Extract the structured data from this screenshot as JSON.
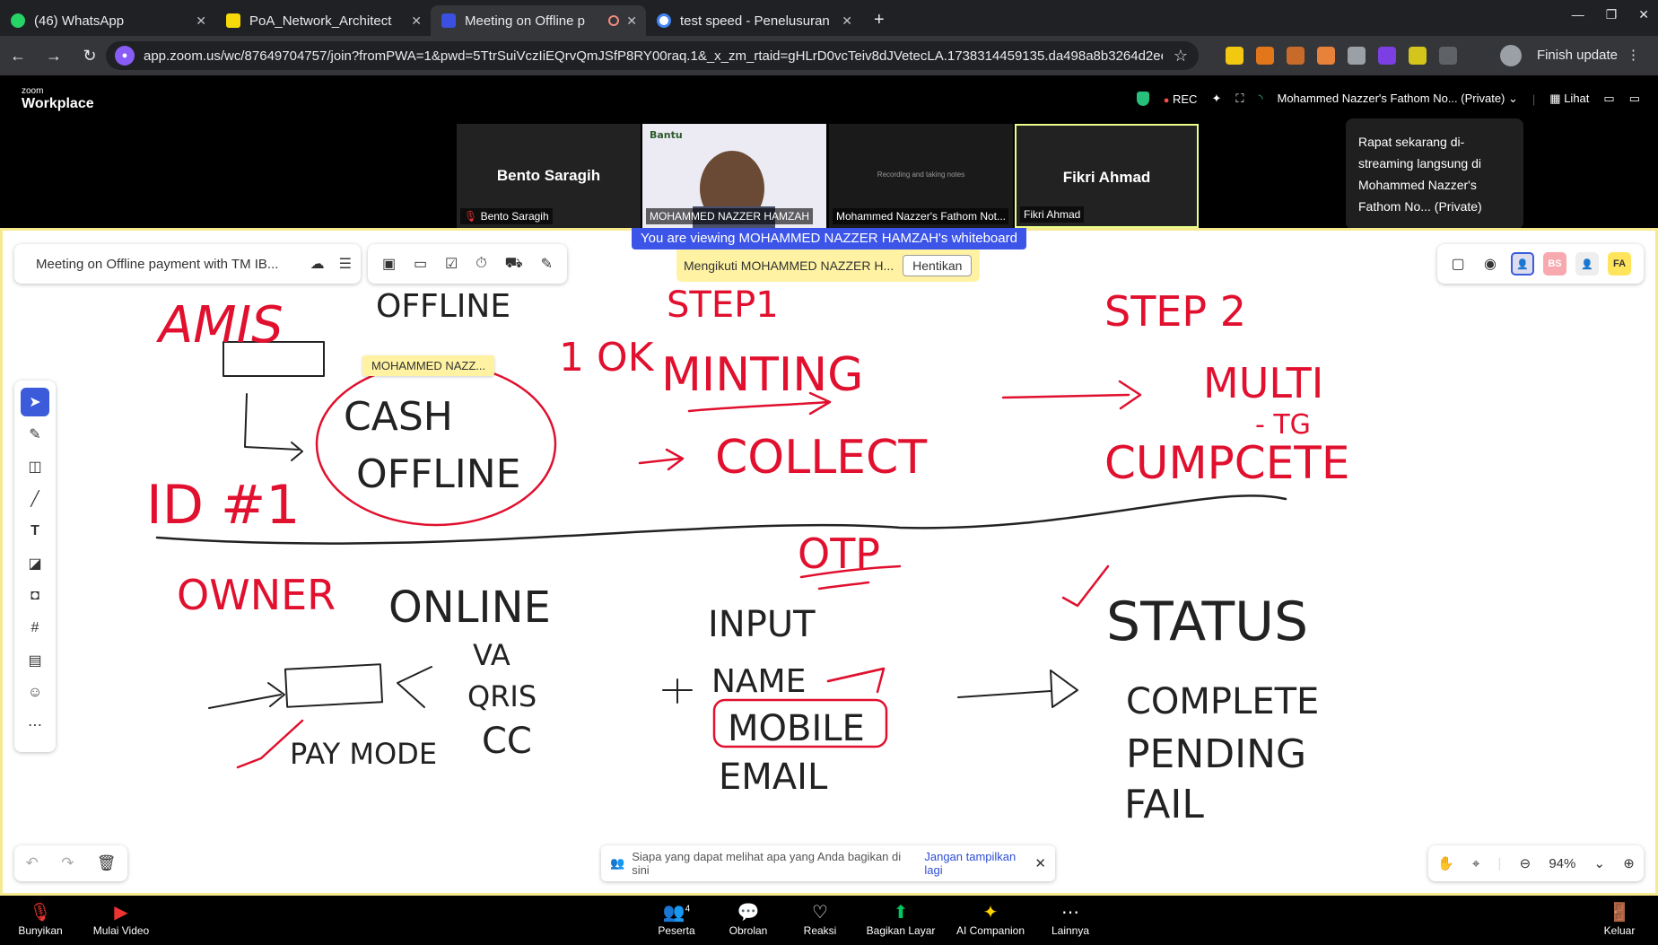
{
  "browser": {
    "tabs": [
      {
        "title": "(46) WhatsApp",
        "favicon_color": "#25d366",
        "active": false
      },
      {
        "title": "PoA_Network_Architect",
        "favicon_color": "#f5d90a",
        "active": false
      },
      {
        "title": "Meeting on Offline p",
        "favicon_color": "#3b4fe0",
        "active": true
      },
      {
        "title": "test speed - Penelusuran",
        "favicon_color": "#ffffff",
        "active": false
      }
    ],
    "new_tab": "+",
    "url": "app.zoom.us/wc/87649704757/join?fromPWA=1&pwd=5TtrSuiVczIiEQrvQmJSfP8RY00raq.1&_x_zm_rtaid=gHLrD0vcTeiv8dJVetecLA.1738314459135.da498a8b3264d2ee2b4d239...",
    "finish_update": "Finish update"
  },
  "zoom": {
    "logo_small": "zoom",
    "logo_big": "Workplace",
    "rec": "REC",
    "stream_target": "Mohammed Nazzer's Fathom No... (Private)",
    "view_label": "Lihat",
    "tooltip": "Rapat sekarang di-streaming langsung di Mohammed Nazzer's Fathom No... (Private)"
  },
  "participants": [
    {
      "name_center": "Bento Saragih",
      "label": "Bento Saragih",
      "muted": true
    },
    {
      "name_center": "",
      "label": "MOHAMMED NAZZER HAMZAH",
      "video_text": "Bantu"
    },
    {
      "name_center": "",
      "label": "Mohammed Nazzer's Fathom Not...",
      "video_text": "Recording and taking notes"
    },
    {
      "name_center": "Fikri Ahmad",
      "label": "Fikri Ahmad",
      "speaking": true
    }
  ],
  "whiteboard": {
    "viewing_banner": "You are viewing MOHAMMED NAZZER HAMZAH's whiteboard",
    "following_text": "Mengikuti MOHAMMED NAZZER H...",
    "stop_button": "Hentikan",
    "title": "Meeting on Offline payment with TM IB...",
    "cursor_tag": "MOHAMMED NAZZ...",
    "avatars": [
      {
        "initials": "BS",
        "color": "#f8a9b0"
      },
      {
        "initials": "FA",
        "color": "#ffe45c"
      }
    ],
    "notice_text": "Siapa yang dapat melihat apa yang Anda bagikan di sini",
    "notice_link": "Jangan tampilkan lagi",
    "zoom_level": "94%",
    "sketch": {
      "amis": "AMIS",
      "offline": "OFFLINE",
      "cash": "CASH",
      "offline2": "OFFLINE",
      "ok": "1 OK",
      "step1": "STEP1",
      "minting": "MINTING",
      "collect": "COLLECT",
      "step2": "STEP 2",
      "multi": "MULTI",
      "multi_sub": "- TG",
      "complete_top": "CUMPCETE",
      "idhash": "ID #1",
      "owner": "OWNER",
      "online": "ONLINE",
      "va": "VA",
      "qris": "QRIS",
      "cc": "CC",
      "pay_mode": "PAY MODE",
      "otp": "OTP",
      "input": "INPUT",
      "name": "NAME",
      "mobile": "MOBILE",
      "email": "EMAIL",
      "status": "STATUS",
      "complete": "COMPLETE",
      "pending": "PENDING",
      "fail": "FAIL"
    }
  },
  "bottom_bar": {
    "items": [
      {
        "label": "Bunyikan",
        "icon": "mic-off-icon"
      },
      {
        "label": "Mulai Video",
        "icon": "video-off-icon"
      },
      {
        "label": "Peserta",
        "icon": "participants-icon",
        "count": "4"
      },
      {
        "label": "Obrolan",
        "icon": "chat-icon"
      },
      {
        "label": "Reaksi",
        "icon": "heart-icon"
      },
      {
        "label": "Bagikan Layar",
        "icon": "share-screen-icon"
      },
      {
        "label": "AI Companion",
        "icon": "sparkle-icon"
      },
      {
        "label": "Lainnya",
        "icon": "more-icon"
      },
      {
        "label": "Keluar",
        "icon": "leave-icon"
      }
    ]
  }
}
